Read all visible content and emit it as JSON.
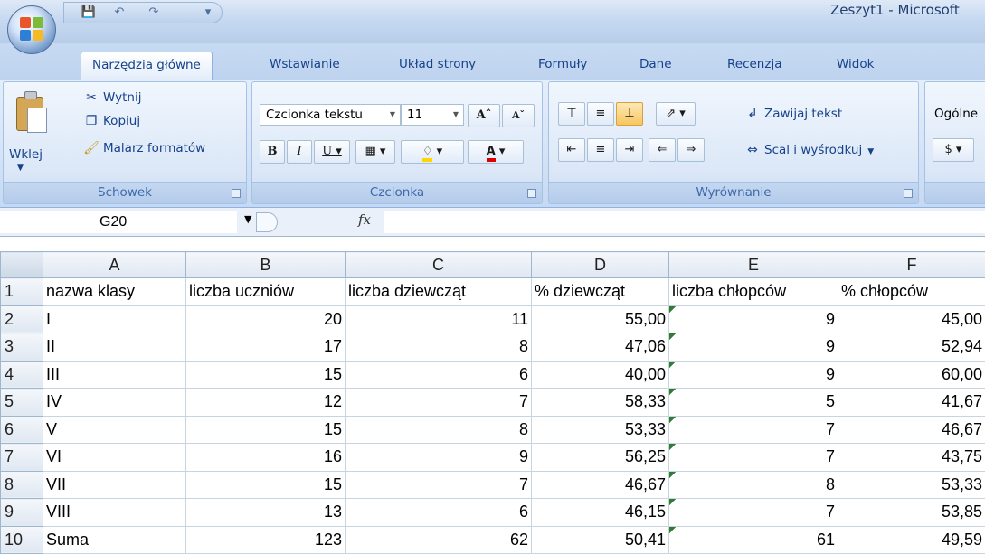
{
  "window": {
    "title": "Zeszyt1 - Microsoft"
  },
  "tabs": [
    "Narzędzia główne",
    "Wstawianie",
    "Układ strony",
    "Formuły",
    "Dane",
    "Recenzja",
    "Widok"
  ],
  "clipboard": {
    "paste_label": "Wklej",
    "cut_label": "Wytnij",
    "copy_label": "Kopiuj",
    "format_painter_label": "Malarz formatów",
    "group_label": "Schowek"
  },
  "font": {
    "font_name": "Czcionka tekstu",
    "font_size": "11",
    "group_label": "Czcionka"
  },
  "alignment": {
    "wrap_text_label": "Zawijaj tekst",
    "merge_center_label": "Scal i wyśrodkuj",
    "group_label": "Wyrównanie"
  },
  "number": {
    "format_value": "Ogólne"
  },
  "formula_bar": {
    "name_box": "G20",
    "fx": "fx",
    "formula": ""
  },
  "sheet": {
    "columns": [
      "A",
      "B",
      "C",
      "D",
      "E",
      "F"
    ],
    "rows": [
      {
        "n": "1",
        "cells": [
          "nazwa klasy",
          "liczba uczniów",
          "liczba dziewcząt",
          "% dziewcząt",
          "liczba chłopców",
          "% chłopców"
        ]
      },
      {
        "n": "2",
        "cells": [
          "I",
          "20",
          "11",
          "55,00",
          "9",
          "45,00"
        ]
      },
      {
        "n": "3",
        "cells": [
          "II",
          "17",
          "8",
          "47,06",
          "9",
          "52,94"
        ]
      },
      {
        "n": "4",
        "cells": [
          "III",
          "15",
          "6",
          "40,00",
          "9",
          "60,00"
        ]
      },
      {
        "n": "5",
        "cells": [
          "IV",
          "12",
          "7",
          "58,33",
          "5",
          "41,67"
        ]
      },
      {
        "n": "6",
        "cells": [
          "V",
          "15",
          "8",
          "53,33",
          "7",
          "46,67"
        ]
      },
      {
        "n": "7",
        "cells": [
          "VI",
          "16",
          "9",
          "56,25",
          "7",
          "43,75"
        ]
      },
      {
        "n": "8",
        "cells": [
          "VII",
          "15",
          "7",
          "46,67",
          "8",
          "53,33"
        ]
      },
      {
        "n": "9",
        "cells": [
          "VIII",
          "13",
          "6",
          "46,15",
          "7",
          "53,85"
        ]
      },
      {
        "n": "10",
        "cells": [
          "Suma",
          "123",
          "62",
          "50,41",
          "61",
          "49,59"
        ]
      }
    ]
  }
}
